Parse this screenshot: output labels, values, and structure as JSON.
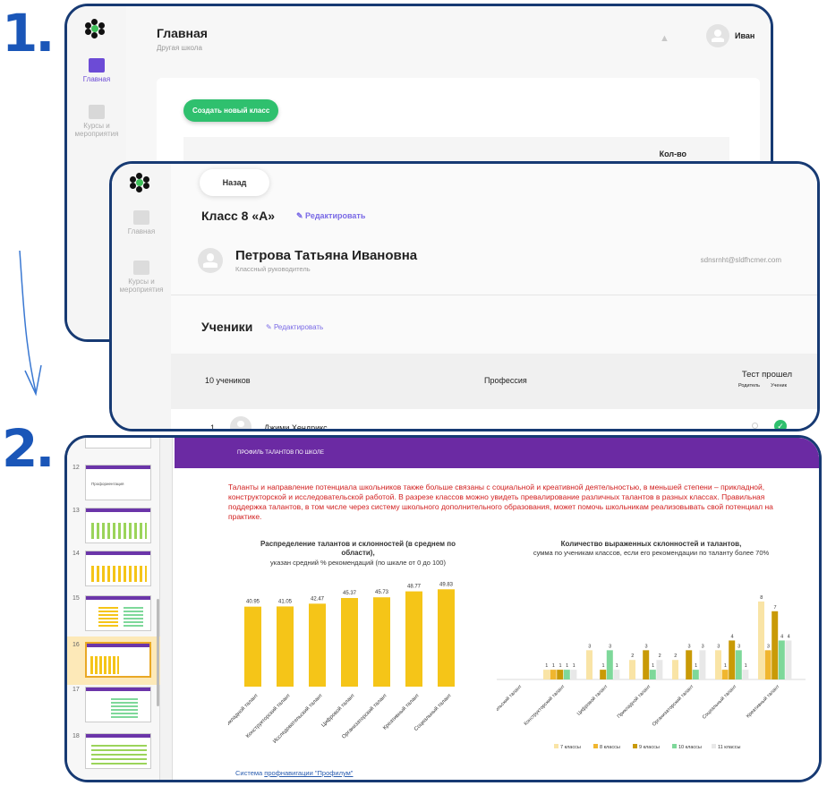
{
  "steps": [
    "1.",
    "2."
  ],
  "window1": {
    "page_title": "Главная",
    "page_subtitle": "Другая школа",
    "user_name": "Иван",
    "sidebar": [
      {
        "label": "Главная"
      },
      {
        "label": "Курсы и мероприятия"
      }
    ],
    "create_button": "Создать новый класс",
    "table_header": "Кол-во"
  },
  "window2": {
    "back_button": "Назад",
    "class_title": "Класс 8 «А»",
    "edit_label": "Редактировать",
    "teacher_name": "Петрова Татьяна Ивановна",
    "teacher_role": "Классный руководитель",
    "teacher_email": "sdnsrnht@sldfhcmer.com",
    "sidebar": [
      {
        "label": "Главная"
      },
      {
        "label": "Курсы и мероприятия"
      }
    ],
    "students_title": "Ученики",
    "students_edit": "Редактировать",
    "columns": {
      "count": "10 учеников",
      "profession": "Профессия",
      "test": "Тест прошел",
      "parent": "Родитель",
      "student": "Ученик"
    },
    "first_row": {
      "num": "1",
      "name": "Джими Хендрикс"
    }
  },
  "window3": {
    "slide_numbers": [
      "12",
      "13",
      "14",
      "15",
      "16",
      "17",
      "18"
    ],
    "thumb12_text": "Профориентация",
    "slide_title": "ПРОФИЛЬ ТАЛАНТОВ ПО ШКОЛЕ",
    "intro_text": "Таланты и направление потенциала школьников также больше связаны с социальной и креативной деятельностью, в меньшей степени – прикладной, конструкторской и исследовательской работой. В разрезе классов можно увидеть превалирование различных талантов в разных классах. Правильная поддержка талантов, в том числе через систему школьного дополнительного образования, может помочь школьникам реализовывать свой потенциал на практике.",
    "footer_prefix": "Система ",
    "footer_link": "профнавигации \"Профилум\""
  },
  "colors": {
    "accent_blue": "#1a56b8",
    "frame": "#173a73",
    "green": "#2fc06e",
    "purple": "#6b2aa3",
    "edit": "#7a6ae6",
    "bar_yellow": "#f5c518"
  },
  "chart_data": [
    {
      "type": "bar",
      "title": "Распределение талантов и склонностей (в среднем по области),",
      "subtitle": "указан средний % рекомендаций (по шкале от 0 до 100)",
      "categories": [
        "Прикладной талант",
        "Конструкторский талант",
        "Исследовательский талант",
        "Цифровой талант",
        "Организаторский талант",
        "Креативный талант",
        "Социальный талант"
      ],
      "values": [
        40.95,
        41.05,
        42.47,
        45.37,
        45.73,
        48.77,
        49.83
      ],
      "labels": [
        "40.95",
        "41.05",
        "42.47",
        "45.37",
        "45.73",
        "48.77",
        "49.83"
      ],
      "ylim": [
        0,
        55
      ],
      "grid": false,
      "color": "#f5c518"
    },
    {
      "type": "bar",
      "title": "Количество выраженных склонностей и талантов,",
      "subtitle": "сумма по ученикам классов, если его рекомендации по таланту более 70%",
      "categories": [
        "Исследовательский талант",
        "Конструкторский талант",
        "Цифровой талант",
        "Прикладной талант",
        "Организаторский талант",
        "Социальный талант",
        "Креативный талант"
      ],
      "series": [
        {
          "name": "7 классы",
          "color": "#f9e4a6",
          "values": [
            0,
            1,
            3,
            2,
            2,
            3,
            8
          ]
        },
        {
          "name": "8 классы",
          "color": "#f0b62f",
          "values": [
            0,
            1,
            0,
            0,
            0,
            1,
            3
          ]
        },
        {
          "name": "9 классы",
          "color": "#c99a07",
          "values": [
            0,
            1,
            1,
            3,
            3,
            4,
            7
          ]
        },
        {
          "name": "10 классы",
          "color": "#7ed89a",
          "values": [
            0,
            1,
            3,
            1,
            1,
            3,
            4
          ]
        },
        {
          "name": "11 классы",
          "color": "#e8e8e8",
          "values": [
            0,
            1,
            1,
            2,
            3,
            1,
            4
          ]
        }
      ],
      "ylim": [
        0,
        9
      ],
      "grid": false,
      "legend": "bottom"
    }
  ]
}
